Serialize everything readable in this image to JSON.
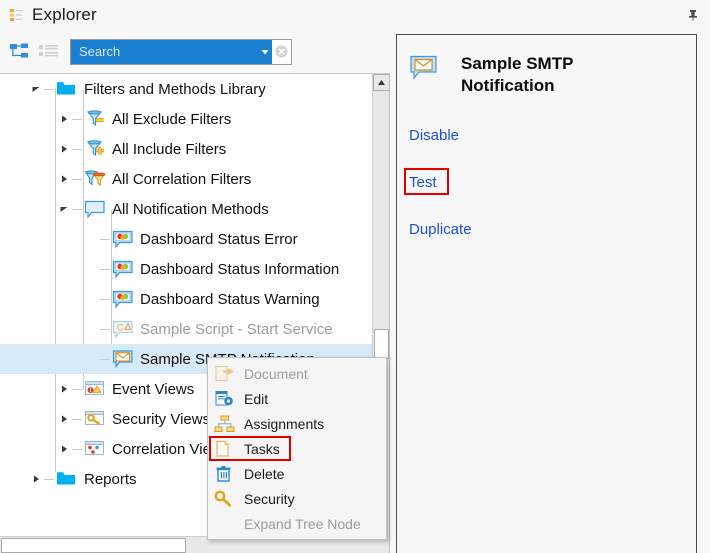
{
  "window": {
    "title": "Explorer",
    "title_icon": "explorer-tree-icon",
    "pin_icon": "pushpin-icon"
  },
  "toolbar": {
    "view_tree_icon": "tree-view-icon",
    "view_list_icon": "list-view-icon",
    "search": {
      "placeholder": "Search",
      "value": "",
      "dropdown_icon": "chevron-down-icon",
      "clear_icon": "clear-circle-icon"
    }
  },
  "tree": {
    "rows": [
      {
        "label": "Filters and Methods Library",
        "icon": "folder-icon",
        "indent": 1,
        "expander": "expanded",
        "state": "normal"
      },
      {
        "label": "All Exclude Filters",
        "icon": "filter-exclude-icon",
        "indent": 2,
        "expander": "collapsed",
        "state": "normal"
      },
      {
        "label": "All Include Filters",
        "icon": "filter-include-icon",
        "indent": 2,
        "expander": "collapsed",
        "state": "normal"
      },
      {
        "label": "All Correlation Filters",
        "icon": "filter-correlation-icon",
        "indent": 2,
        "expander": "collapsed",
        "state": "normal"
      },
      {
        "label": "All Notification Methods",
        "icon": "notification-icon",
        "indent": 2,
        "expander": "expanded",
        "state": "normal"
      },
      {
        "label": "Dashboard Status Error",
        "icon": "dashboard-status-icon",
        "indent": 3,
        "expander": "none",
        "state": "normal"
      },
      {
        "label": "Dashboard Status Information",
        "icon": "dashboard-status-icon",
        "indent": 3,
        "expander": "none",
        "state": "normal"
      },
      {
        "label": "Dashboard Status Warning",
        "icon": "dashboard-status-icon",
        "indent": 3,
        "expander": "none",
        "state": "normal"
      },
      {
        "label": "Sample Script - Start Service",
        "icon": "script-method-icon",
        "indent": 3,
        "expander": "none",
        "state": "disabled"
      },
      {
        "label": "Sample SMTP Notification",
        "icon": "smtp-mail-icon",
        "indent": 3,
        "expander": "none",
        "state": "selected"
      },
      {
        "label": "Event Views",
        "icon": "event-views-icon",
        "indent": 2,
        "expander": "collapsed",
        "state": "normal"
      },
      {
        "label": "Security Views",
        "icon": "security-views-icon",
        "indent": 2,
        "expander": "collapsed",
        "state": "normal"
      },
      {
        "label": "Correlation Views",
        "icon": "correlation-views-icon",
        "indent": 2,
        "expander": "collapsed",
        "state": "normal"
      },
      {
        "label": "Reports",
        "icon": "folder-icon",
        "indent": 1,
        "expander": "collapsed",
        "state": "normal"
      }
    ],
    "scrollbar": {
      "up_arrow_icon": "scroll-up-arrow-icon",
      "vertical_thumb_icon": "vertical-scroll-thumb",
      "horizontal_thumb_icon": "horizontal-scroll-thumb"
    }
  },
  "context_menu": {
    "items": [
      {
        "label": "Document",
        "icon": "document-icon",
        "state": "disabled",
        "highlighted": false
      },
      {
        "label": "Edit",
        "icon": "edit-gear-icon",
        "state": "normal",
        "highlighted": false
      },
      {
        "label": "Assignments",
        "icon": "assignments-icon",
        "state": "normal",
        "highlighted": false
      },
      {
        "label": "Tasks",
        "icon": "tasks-icon",
        "state": "normal",
        "highlighted": true
      },
      {
        "label": "Delete",
        "icon": "trash-icon",
        "state": "normal",
        "highlighted": false
      },
      {
        "label": "Security",
        "icon": "key-icon",
        "state": "normal",
        "highlighted": false
      },
      {
        "label": "Expand Tree Node",
        "icon": "none",
        "state": "disabled",
        "highlighted": false
      }
    ]
  },
  "detail": {
    "icon": "smtp-mail-icon",
    "title": "Sample SMTP Notification",
    "links": [
      {
        "label": "Disable",
        "highlighted": false
      },
      {
        "label": "Test",
        "highlighted": true
      },
      {
        "label": "Duplicate",
        "highlighted": false
      }
    ]
  },
  "colors": {
    "accent_blue": "#1b7fd1",
    "link_blue": "#1a4fd6",
    "highlight_red": "#e00000",
    "selection_blue": "#d6e9f8",
    "panel_bg": "#f7f7f7"
  }
}
